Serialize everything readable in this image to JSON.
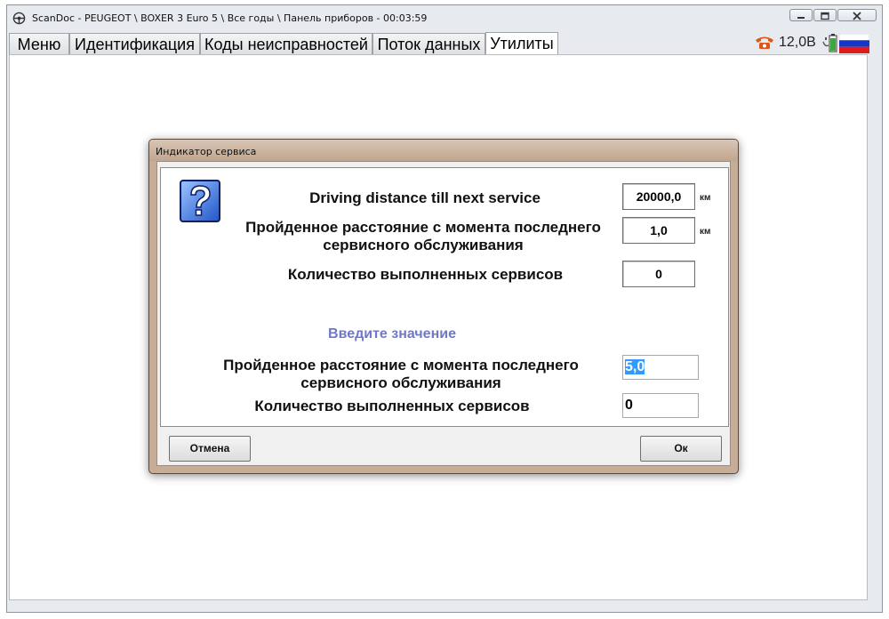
{
  "window": {
    "title": "ScanDoc - PEUGEOT \\ BOXER 3 Euro 5 \\ Все годы \\ Панель приборов - 00:03:59"
  },
  "tabs": [
    {
      "label": "Меню"
    },
    {
      "label": "Идентификация"
    },
    {
      "label": "Коды неисправностей"
    },
    {
      "label": "Поток данных"
    },
    {
      "label": "Утилиты",
      "active": true
    }
  ],
  "status": {
    "phone_icon": "phone-icon",
    "voltage": "12,0В",
    "battery_icon": "battery-icon",
    "flag_icon": "russia-flag-icon"
  },
  "dialog": {
    "title": "Индикатор сервиса",
    "icon": "question-mark-icon",
    "rows": [
      {
        "label": "Driving distance till next service",
        "value": "20000,0",
        "unit": "км"
      },
      {
        "label": "Пройденное расстояние с момента последнего сервисного обслуживания",
        "value": "1,0",
        "unit": "км"
      },
      {
        "label": "Количество выполненных сервисов",
        "value": "0"
      }
    ],
    "prompt": "Введите значение",
    "inputs": [
      {
        "label": "Пройденное расстояние с момента последнего сервисного обслуживания",
        "value": "5,0"
      },
      {
        "label": "Количество выполненных сервисов",
        "value": "0"
      }
    ],
    "cancel_label": "Отмена",
    "ok_label": "Ок"
  },
  "colors": {
    "prompt": "#6f78c9",
    "dialog_frame": "#c6ad98",
    "selection": "#3399ff"
  }
}
